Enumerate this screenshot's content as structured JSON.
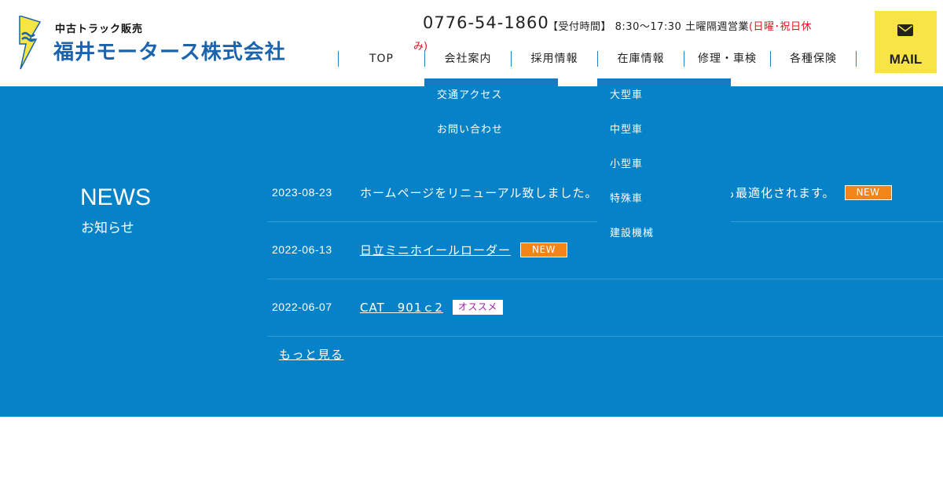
{
  "header": {
    "logo_sub": "中古トラック販売",
    "logo_main": "福井モータース株式会社",
    "phone": "0776-54-1860",
    "hours_label": "【受付時間】",
    "hours_time": "8:30〜17:30",
    "hours_note": "土曜隔週営業",
    "hours_closed": "(日曜･祝日休",
    "hours_closed_tail": "み)",
    "mail_label": "MAIL"
  },
  "nav": {
    "items": [
      "TOP",
      "会社案内",
      "採用情報",
      "在庫情報",
      "修理・車検",
      "各種保険"
    ]
  },
  "dropdowns": {
    "company": [
      "交通アクセス",
      "お問い合わせ"
    ],
    "stock": [
      "大型車",
      "中型車",
      "小型車",
      "特殊車",
      "建設機械"
    ]
  },
  "news": {
    "title": "NEWS",
    "subtitle": "お知らせ",
    "items": [
      {
        "date": "2023-08-23",
        "text": "ホームページをリニューアル致しました。スマートフォンの表示も最適化されます。",
        "badge": "NEW"
      },
      {
        "date": "2022-06-13",
        "text": "日立ミニホイールローダー",
        "badge": "NEW"
      },
      {
        "date": "2022-06-07",
        "text": "CAT　901ｃ2",
        "badge": "オススメ"
      }
    ],
    "more": "もっと見る"
  },
  "colors": {
    "brand_blue": "#1b64ad",
    "section_blue": "#0582c8",
    "mail_yellow": "#f8e444",
    "badge_orange": "#f28518",
    "closed_red": "#e0141e"
  }
}
